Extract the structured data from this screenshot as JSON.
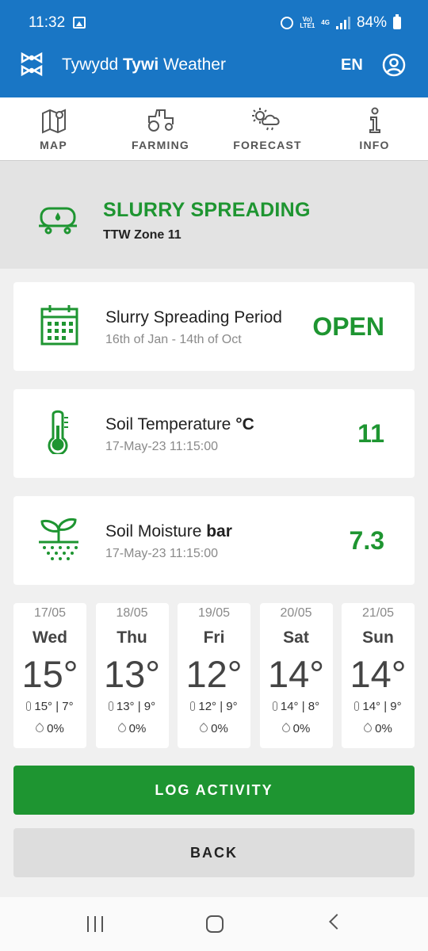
{
  "status_bar": {
    "time": "11:32",
    "network_top": "Vo)",
    "network_bottom": "LTE1",
    "network_type": "4G",
    "battery": "84%"
  },
  "app_bar": {
    "title_pre": "Tywydd ",
    "title_bold": "Tywi",
    "title_post": " Weather",
    "language": "EN",
    "icons": {
      "logo": "farm-logo-icon",
      "account": "account-circle-icon"
    }
  },
  "nav": {
    "items": [
      {
        "label": "MAP",
        "icon": "map-pin-icon"
      },
      {
        "label": "FARMING",
        "icon": "tractor-icon"
      },
      {
        "label": "FORECAST",
        "icon": "weather-icon"
      },
      {
        "label": "INFO",
        "icon": "info-icon"
      }
    ]
  },
  "header": {
    "title": "SLURRY SPREADING",
    "zone": "TTW Zone 11",
    "icon": "slurry-tanker-icon"
  },
  "cards": [
    {
      "title": "Slurry Spreading Period",
      "title_bold": "",
      "subtitle": "16th of Jan - 14th of Oct",
      "value": "OPEN",
      "icon": "calendar-icon"
    },
    {
      "title": "Soil Temperature ",
      "title_bold": "°C",
      "subtitle": "17-May-23 11:15:00",
      "value": "11",
      "icon": "thermometer-icon"
    },
    {
      "title": "Soil Moisture ",
      "title_bold": "bar",
      "subtitle": "17-May-23 11:15:00",
      "value": "7.3",
      "icon": "plant-soil-icon"
    }
  ],
  "forecast": [
    {
      "date": "17/05",
      "day": "Wed",
      "temp": "15°",
      "hi": "15°",
      "lo": "7°",
      "rain": "0%"
    },
    {
      "date": "18/05",
      "day": "Thu",
      "temp": "13°",
      "hi": "13°",
      "lo": "9°",
      "rain": "0%"
    },
    {
      "date": "19/05",
      "day": "Fri",
      "temp": "12°",
      "hi": "12°",
      "lo": "9°",
      "rain": "0%"
    },
    {
      "date": "20/05",
      "day": "Sat",
      "temp": "14°",
      "hi": "14°",
      "lo": "8°",
      "rain": "0%"
    },
    {
      "date": "21/05",
      "day": "Sun",
      "temp": "14°",
      "hi": "14°",
      "lo": "9°",
      "rain": "0%"
    }
  ],
  "buttons": {
    "log": "LOG ACTIVITY",
    "back": "BACK"
  },
  "colors": {
    "brand_blue": "#1976c5",
    "accent_green": "#1e9531"
  }
}
